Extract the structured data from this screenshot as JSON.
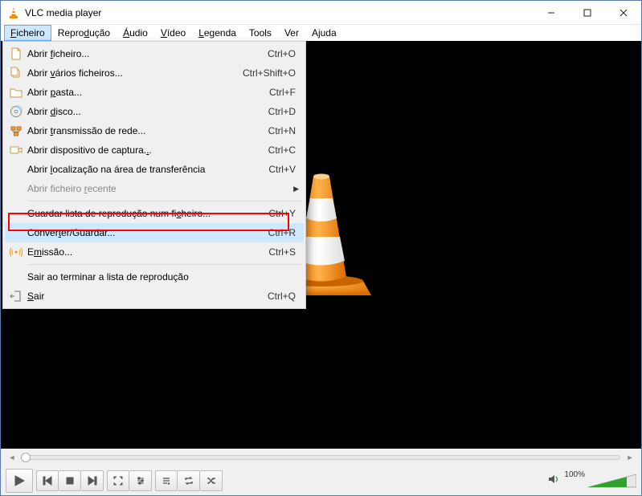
{
  "window": {
    "title": "VLC media player"
  },
  "menubar": [
    {
      "label": "Ficheiro",
      "u": 0,
      "open": true
    },
    {
      "label": "Reprodução",
      "u": 5
    },
    {
      "label": "Áudio",
      "u": 0
    },
    {
      "label": "Vídeo",
      "u": 0
    },
    {
      "label": "Legenda",
      "u": 0
    },
    {
      "label": "Tools",
      "u": -1
    },
    {
      "label": "Ver",
      "u": -1
    },
    {
      "label": "Ajuda",
      "u": -1
    }
  ],
  "dropdown": [
    {
      "icon": "file",
      "label": "Abrir ficheiro...",
      "u": 6,
      "shortcut": "Ctrl+O"
    },
    {
      "icon": "files",
      "label": "Abrir vários ficheiros...",
      "u": 6,
      "shortcut": "Ctrl+Shift+O"
    },
    {
      "icon": "folder",
      "label": "Abrir pasta...",
      "u": 6,
      "shortcut": "Ctrl+F"
    },
    {
      "icon": "disc",
      "label": "Abrir disco...",
      "u": 6,
      "shortcut": "Ctrl+D"
    },
    {
      "icon": "network",
      "label": "Abrir transmissão de rede...",
      "u": 6,
      "shortcut": "Ctrl+N"
    },
    {
      "icon": "capture",
      "label": "Abrir dispositivo de captura...",
      "u": 29,
      "shortcut": "Ctrl+C"
    },
    {
      "icon": "",
      "label": "Abrir localização na área de transferência",
      "u": 6,
      "shortcut": "Ctrl+V"
    },
    {
      "icon": "",
      "label": "Abrir ficheiro recente",
      "u": 15,
      "shortcut": "",
      "disabled": true,
      "submenu": true
    },
    {
      "sep": true
    },
    {
      "icon": "",
      "label": "Guardar lista de reprodução num ficheiro...",
      "u": 34,
      "shortcut": "Ctrl+Y"
    },
    {
      "icon": "",
      "label": "Converter/Guardar...",
      "u": 6,
      "shortcut": "Ctrl+R",
      "hover": true,
      "highlight": true
    },
    {
      "icon": "stream",
      "label": "Emissão...",
      "u": 1,
      "shortcut": "Ctrl+S"
    },
    {
      "sep": true
    },
    {
      "icon": "",
      "label": "Sair ao terminar a lista de reprodução",
      "u": -1,
      "shortcut": ""
    },
    {
      "icon": "exit",
      "label": "Sair",
      "u": 0,
      "shortcut": "Ctrl+Q"
    }
  ],
  "controls": {
    "volume_label": "100%"
  }
}
